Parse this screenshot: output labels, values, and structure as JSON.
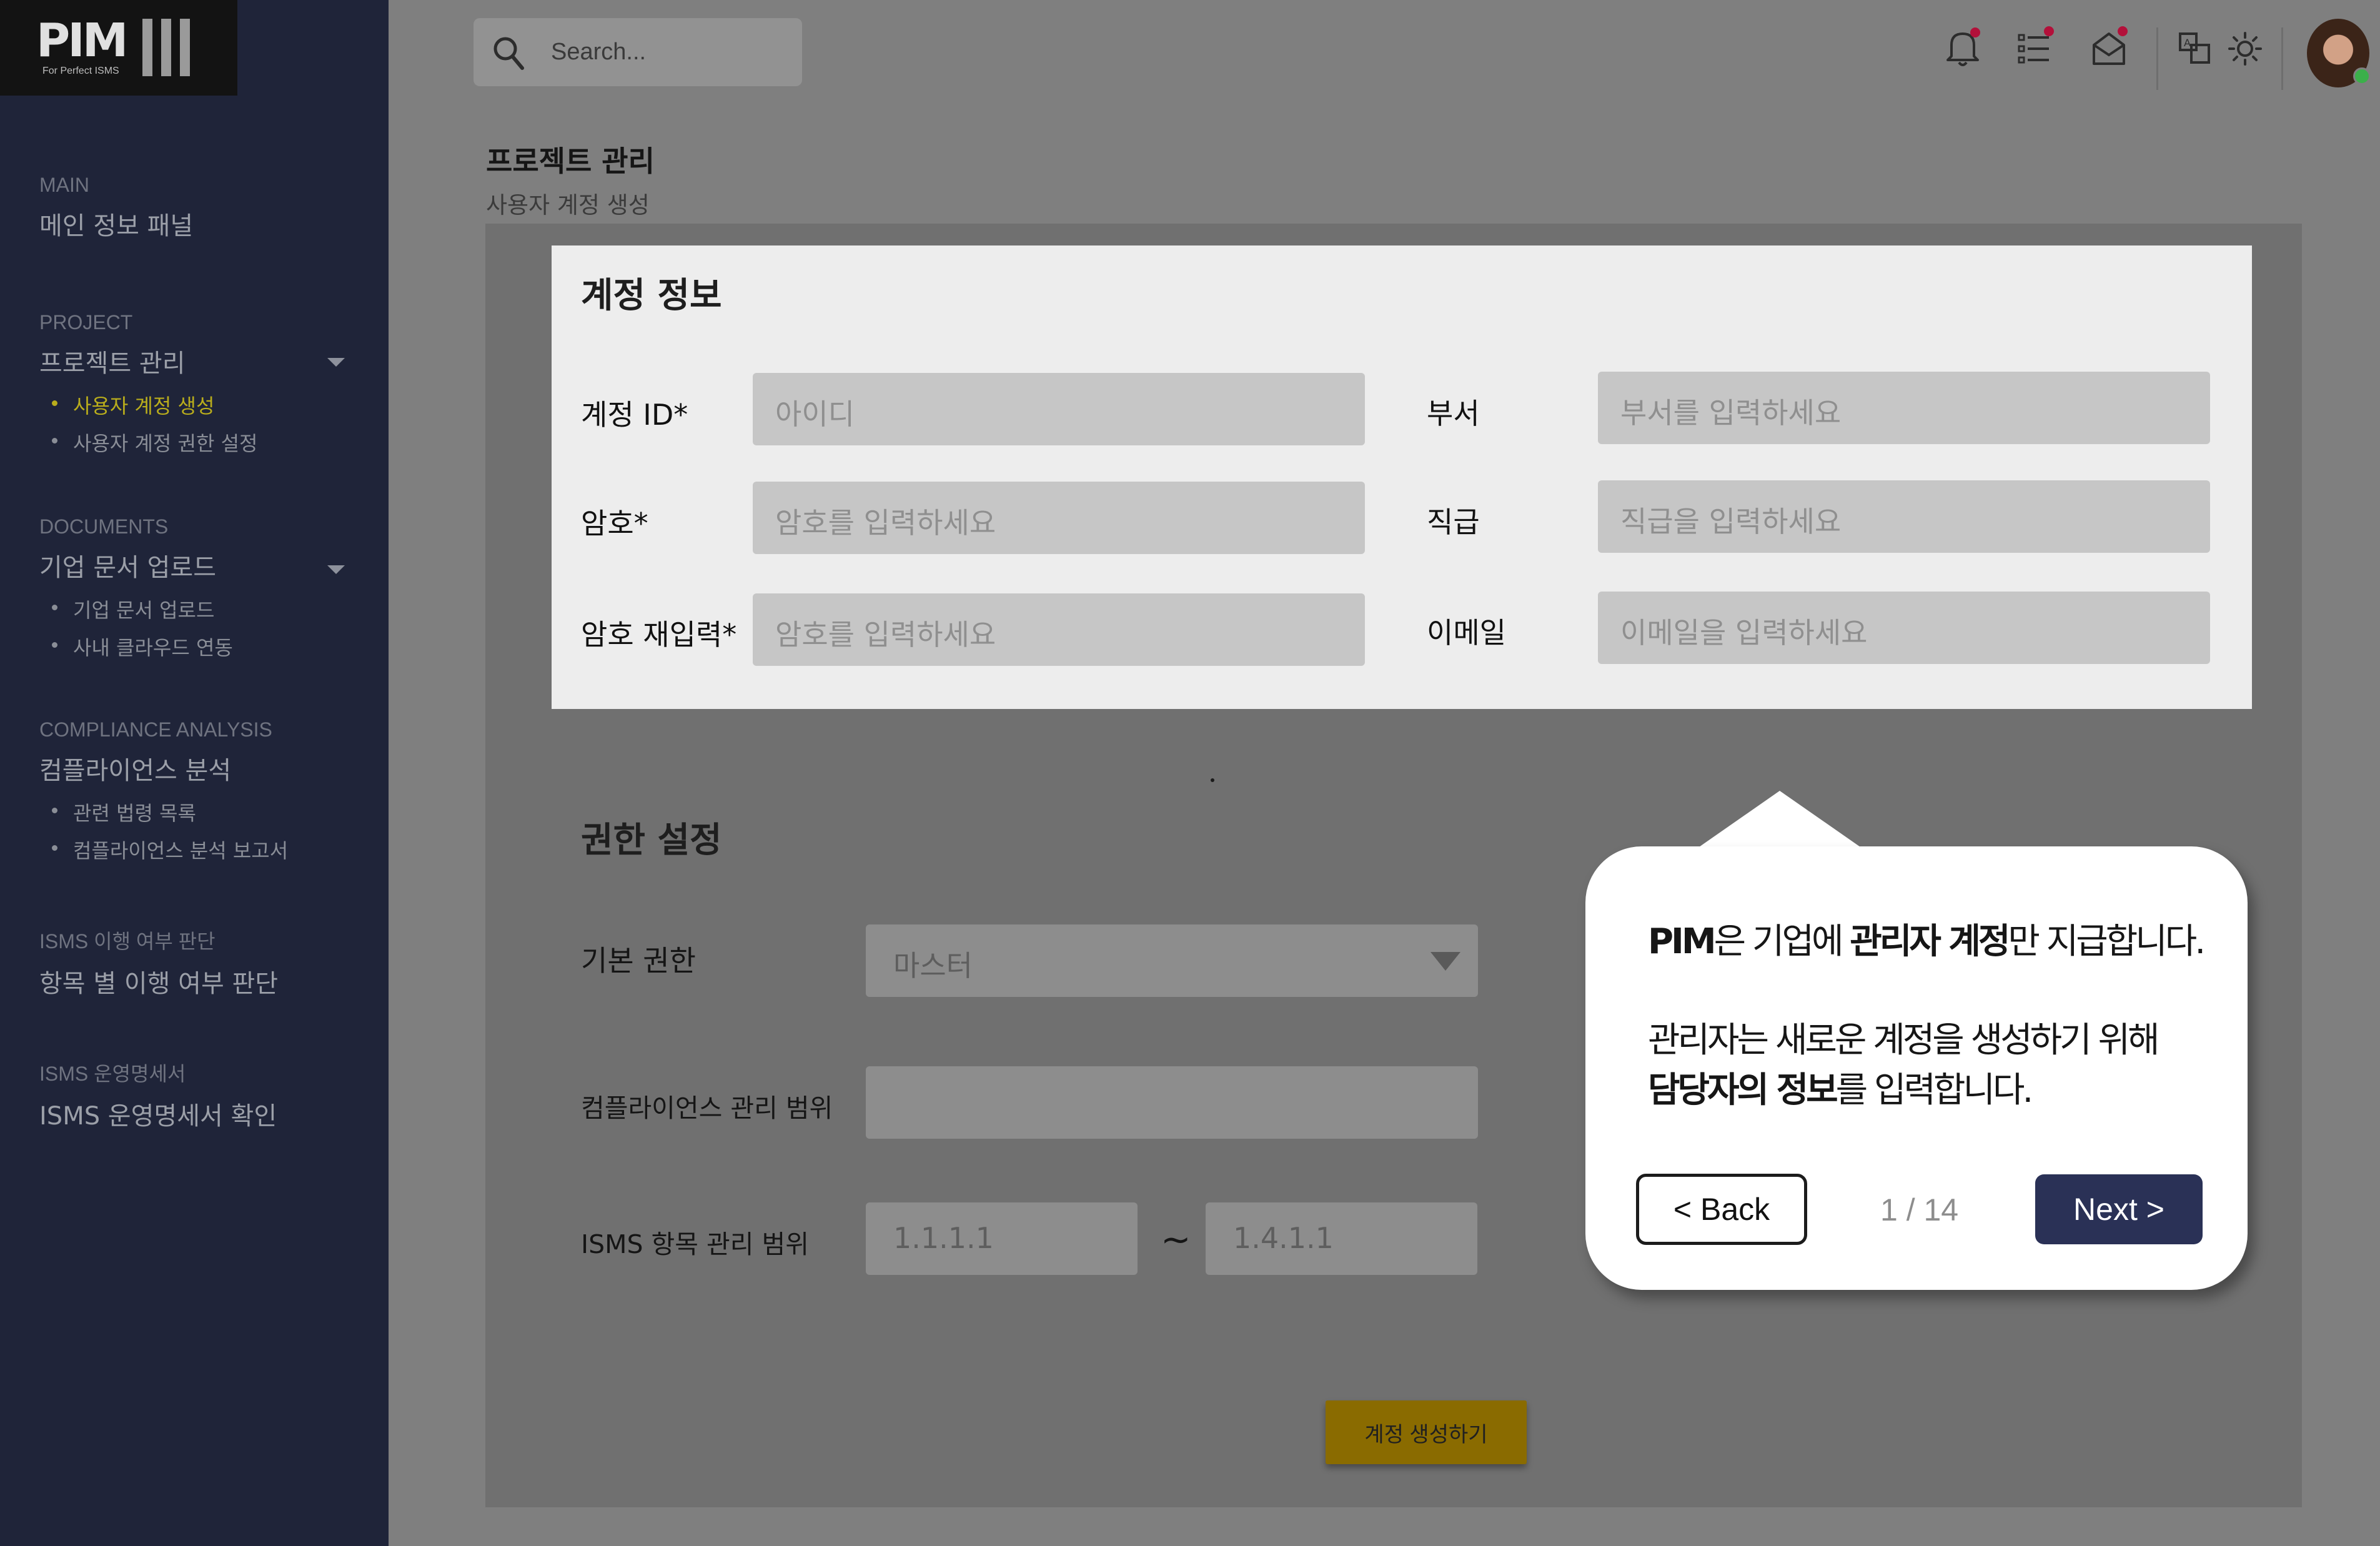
{
  "brand": {
    "logo": "PIM",
    "tagline": "For Perfect ISMS"
  },
  "sidebar": {
    "sections": [
      {
        "category": "MAIN",
        "head": "메인 정보 패널",
        "items": []
      },
      {
        "category": "PROJECT",
        "head": "프로젝트 관리",
        "items": [
          "사용자 계정 생성",
          "사용자 계정 권한 설정"
        ]
      },
      {
        "category": "DOCUMENTS",
        "head": "기업 문서 업로드",
        "items": [
          "기업 문서 업로드",
          "사내 클라우드 연동"
        ]
      },
      {
        "category": "COMPLIANCE ANALYSIS",
        "head": "컴플라이언스 분석",
        "items": [
          "관련 법령 목록",
          "컴플라이언스 분석 보고서"
        ]
      },
      {
        "category": "ISMS 이행 여부 판단",
        "head": "항목 별 이행 여부 판단",
        "items": []
      },
      {
        "category": "ISMS 운영명세서",
        "head": "ISMS 운영명세서 확인",
        "items": []
      }
    ],
    "active_item": "사용자 계정 생성"
  },
  "header": {
    "search_placeholder": "Search...",
    "icons": [
      "bell-icon",
      "list-icon",
      "mail-icon",
      "translate-icon",
      "sun-icon"
    ]
  },
  "page": {
    "title": "프로젝트 관리",
    "subtitle": "사용자 계정 생성"
  },
  "account": {
    "title": "계정 정보",
    "fields": [
      {
        "label": "계정 ID*",
        "placeholder": "아이디"
      },
      {
        "label": "암호*",
        "placeholder": "암호를 입력하세요"
      },
      {
        "label": "암호 재입력*",
        "placeholder": "암호를 입력하세요"
      },
      {
        "label": "부서",
        "placeholder": "부서를 입력하세요"
      },
      {
        "label": "직급",
        "placeholder": "직급을 입력하세요"
      },
      {
        "label": "이메일",
        "placeholder": "이메일을 입력하세요"
      }
    ]
  },
  "permission": {
    "title": "권한 설정",
    "basic_label": "기본 권한",
    "basic_value": "마스터",
    "compliance_label": "컴플라이언스 관리 범위",
    "isms_label": "ISMS 항목 관리 범위",
    "isms_from": "1.1.1.1",
    "isms_to": "1.4.1.1",
    "range_sep": "~",
    "create_button": "계정 생성하기"
  },
  "tooltip": {
    "line1_prefix": "PIM",
    "line1_mid1": "은 기업에 ",
    "line1_bold": "관리자 계정",
    "line1_mid2": "만 지급합니다.",
    "line2": "관리자는 새로운 계정을 생성하기 위해",
    "line3_bold": "담당자의 정보",
    "line3_rest": "를 입력합니다.",
    "back": "< Back",
    "page": "1 / 14",
    "next": "Next >"
  }
}
